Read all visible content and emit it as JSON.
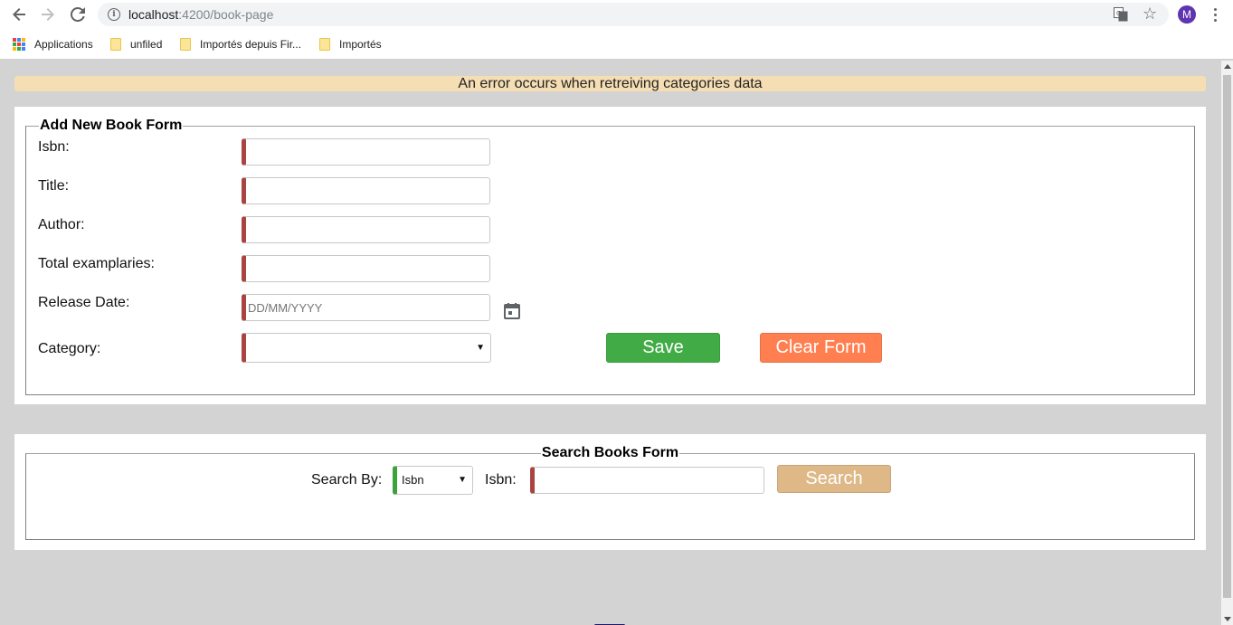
{
  "browser": {
    "url_host": "localhost",
    "url_path": ":4200/book-page",
    "avatar_letter": "M",
    "bookmarks": [
      {
        "label": "Applications"
      },
      {
        "label": "unfiled"
      },
      {
        "label": "Importés depuis Fir..."
      },
      {
        "label": "Importés"
      }
    ]
  },
  "error_banner": {
    "text": "An error occurs when retreiving categories data",
    "color": "#f5deb3"
  },
  "add_form": {
    "legend": "Add New Book Form",
    "fields": {
      "isbn": {
        "label": "Isbn:",
        "value": ""
      },
      "title": {
        "label": "Title:",
        "value": ""
      },
      "author": {
        "label": "Author:",
        "value": ""
      },
      "total": {
        "label": "Total examplaries:",
        "value": ""
      },
      "release": {
        "label": "Release Date:",
        "placeholder": "DD/MM/YYYY"
      },
      "category": {
        "label": "Category:",
        "selected": ""
      }
    },
    "save_label": "Save",
    "clear_label": "Clear Form"
  },
  "search_form": {
    "legend": "Search Books Form",
    "search_by_label": "Search By:",
    "search_by_selected": "Isbn",
    "isbn_label": "Isbn:",
    "isbn_value": "",
    "search_label": "Search"
  },
  "colors": {
    "invalid_border": "#a94442",
    "valid_border": "#3aa33a",
    "save": "#41ab45",
    "clear": "#ff7f50",
    "search": "#deb887"
  }
}
